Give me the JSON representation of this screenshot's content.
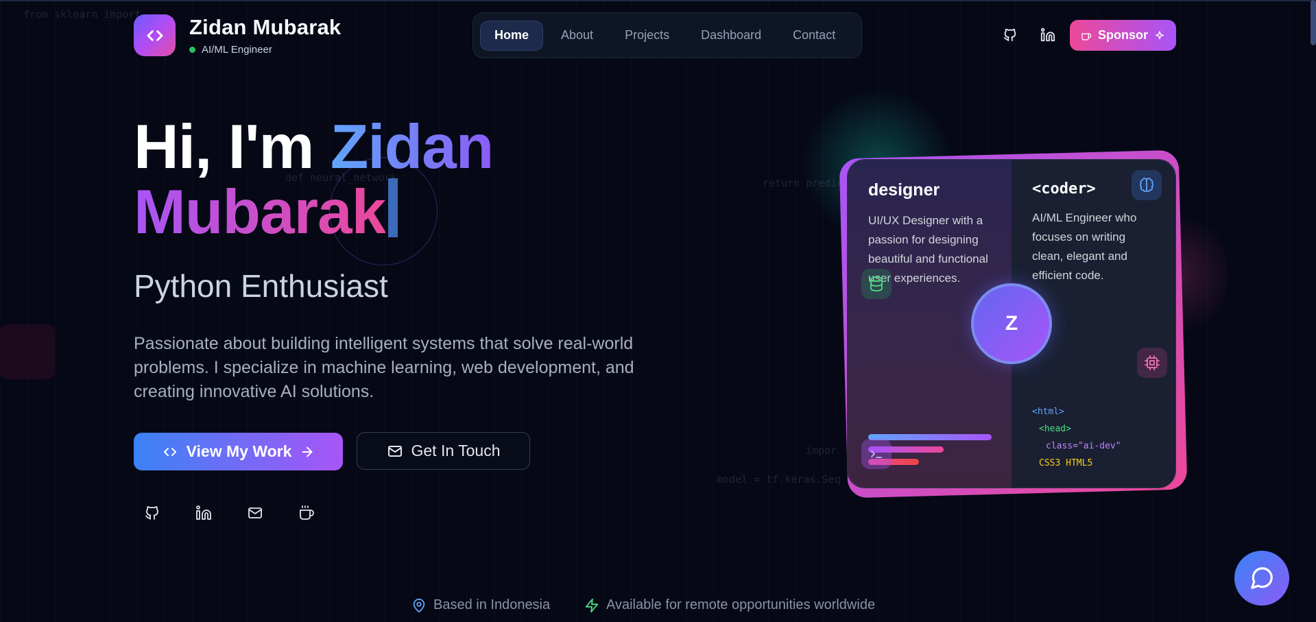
{
  "background_code": {
    "top_left": "from sklearn import ...",
    "neural": "def neural_network",
    "predict": "return predic",
    "import": "impor",
    "model": "model = tf.keras.Seq"
  },
  "header": {
    "name": "Zidan Mubarak",
    "role": "AI/ML Engineer",
    "sponsor_label": "Sponsor"
  },
  "nav": {
    "items": [
      {
        "label": "Home",
        "active": true
      },
      {
        "label": "About",
        "active": false
      },
      {
        "label": "Projects",
        "active": false
      },
      {
        "label": "Dashboard",
        "active": false
      },
      {
        "label": "Contact",
        "active": false
      }
    ]
  },
  "hero": {
    "greeting": "Hi, I'm",
    "first_name": "Zidan",
    "last_name": "Mubarak",
    "subtitle": "Python Enthusiast",
    "description": "Passionate about building intelligent systems that solve real-world problems. I specialize in machine learning, web development, and creating innovative AI solutions.",
    "primary_button": "View My Work",
    "secondary_button": "Get In Touch"
  },
  "card": {
    "left_title": "designer",
    "left_text": "UI/UX Designer with a passion for designing beautiful and functional user experiences.",
    "right_title": "<coder>",
    "right_text": "AI/ML Engineer who focuses on writing clean, elegant and efficient code.",
    "avatar_letter": "Z",
    "code_lines": [
      "<html>",
      "<head>",
      "class=\"ai-dev\"",
      "CSS3 HTML5"
    ]
  },
  "footer": {
    "location": "Based in Indonesia",
    "availability": "Available for remote opportunities worldwide"
  },
  "colors": {
    "background": "#060816",
    "accent_blue": "#3b82f6",
    "accent_purple": "#a855f7",
    "accent_pink": "#ec4899",
    "status_green": "#22c55e"
  },
  "icons": [
    "code-icon",
    "github-icon",
    "linkedin-icon",
    "sparkle-icon",
    "coffee-icon",
    "arrow-right-icon",
    "mail-icon",
    "map-pin-icon",
    "zap-icon",
    "chat-icon",
    "brain-icon",
    "database-icon",
    "cpu-icon",
    "terminal-icon"
  ]
}
